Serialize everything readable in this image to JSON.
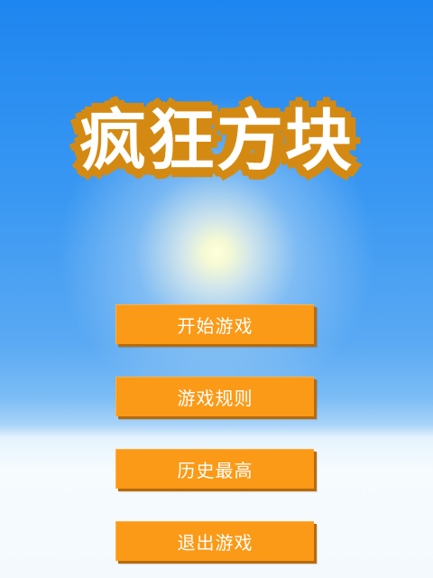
{
  "game": {
    "title": "疯狂方块"
  },
  "menu": {
    "start_label": "开始游戏",
    "rules_label": "游戏规则",
    "best_label": "历史最高",
    "quit_label": "退出游戏"
  },
  "colors": {
    "sky_top": "#1e86f0",
    "sky_bottom": "#f6fbfe",
    "button_fill": "#fb9a17",
    "button_shadow": "#b96a08",
    "title_outline": "#d48a12",
    "title_fill": "#ffffff"
  }
}
